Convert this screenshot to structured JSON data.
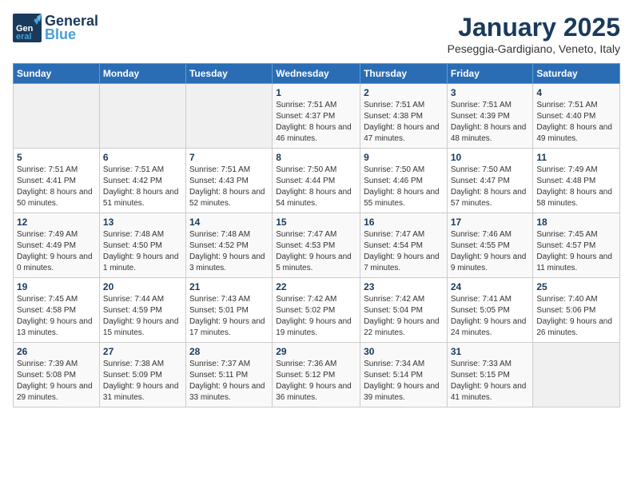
{
  "header": {
    "logo_general": "General",
    "logo_blue": "Blue",
    "month": "January 2025",
    "location": "Peseggia-Gardigiano, Veneto, Italy"
  },
  "days_of_week": [
    "Sunday",
    "Monday",
    "Tuesday",
    "Wednesday",
    "Thursday",
    "Friday",
    "Saturday"
  ],
  "weeks": [
    [
      {
        "num": "",
        "info": ""
      },
      {
        "num": "",
        "info": ""
      },
      {
        "num": "",
        "info": ""
      },
      {
        "num": "1",
        "info": "Sunrise: 7:51 AM\nSunset: 4:37 PM\nDaylight: 8 hours and 46 minutes."
      },
      {
        "num": "2",
        "info": "Sunrise: 7:51 AM\nSunset: 4:38 PM\nDaylight: 8 hours and 47 minutes."
      },
      {
        "num": "3",
        "info": "Sunrise: 7:51 AM\nSunset: 4:39 PM\nDaylight: 8 hours and 48 minutes."
      },
      {
        "num": "4",
        "info": "Sunrise: 7:51 AM\nSunset: 4:40 PM\nDaylight: 8 hours and 49 minutes."
      }
    ],
    [
      {
        "num": "5",
        "info": "Sunrise: 7:51 AM\nSunset: 4:41 PM\nDaylight: 8 hours and 50 minutes."
      },
      {
        "num": "6",
        "info": "Sunrise: 7:51 AM\nSunset: 4:42 PM\nDaylight: 8 hours and 51 minutes."
      },
      {
        "num": "7",
        "info": "Sunrise: 7:51 AM\nSunset: 4:43 PM\nDaylight: 8 hours and 52 minutes."
      },
      {
        "num": "8",
        "info": "Sunrise: 7:50 AM\nSunset: 4:44 PM\nDaylight: 8 hours and 54 minutes."
      },
      {
        "num": "9",
        "info": "Sunrise: 7:50 AM\nSunset: 4:46 PM\nDaylight: 8 hours and 55 minutes."
      },
      {
        "num": "10",
        "info": "Sunrise: 7:50 AM\nSunset: 4:47 PM\nDaylight: 8 hours and 57 minutes."
      },
      {
        "num": "11",
        "info": "Sunrise: 7:49 AM\nSunset: 4:48 PM\nDaylight: 8 hours and 58 minutes."
      }
    ],
    [
      {
        "num": "12",
        "info": "Sunrise: 7:49 AM\nSunset: 4:49 PM\nDaylight: 9 hours and 0 minutes."
      },
      {
        "num": "13",
        "info": "Sunrise: 7:48 AM\nSunset: 4:50 PM\nDaylight: 9 hours and 1 minute."
      },
      {
        "num": "14",
        "info": "Sunrise: 7:48 AM\nSunset: 4:52 PM\nDaylight: 9 hours and 3 minutes."
      },
      {
        "num": "15",
        "info": "Sunrise: 7:47 AM\nSunset: 4:53 PM\nDaylight: 9 hours and 5 minutes."
      },
      {
        "num": "16",
        "info": "Sunrise: 7:47 AM\nSunset: 4:54 PM\nDaylight: 9 hours and 7 minutes."
      },
      {
        "num": "17",
        "info": "Sunrise: 7:46 AM\nSunset: 4:55 PM\nDaylight: 9 hours and 9 minutes."
      },
      {
        "num": "18",
        "info": "Sunrise: 7:45 AM\nSunset: 4:57 PM\nDaylight: 9 hours and 11 minutes."
      }
    ],
    [
      {
        "num": "19",
        "info": "Sunrise: 7:45 AM\nSunset: 4:58 PM\nDaylight: 9 hours and 13 minutes."
      },
      {
        "num": "20",
        "info": "Sunrise: 7:44 AM\nSunset: 4:59 PM\nDaylight: 9 hours and 15 minutes."
      },
      {
        "num": "21",
        "info": "Sunrise: 7:43 AM\nSunset: 5:01 PM\nDaylight: 9 hours and 17 minutes."
      },
      {
        "num": "22",
        "info": "Sunrise: 7:42 AM\nSunset: 5:02 PM\nDaylight: 9 hours and 19 minutes."
      },
      {
        "num": "23",
        "info": "Sunrise: 7:42 AM\nSunset: 5:04 PM\nDaylight: 9 hours and 22 minutes."
      },
      {
        "num": "24",
        "info": "Sunrise: 7:41 AM\nSunset: 5:05 PM\nDaylight: 9 hours and 24 minutes."
      },
      {
        "num": "25",
        "info": "Sunrise: 7:40 AM\nSunset: 5:06 PM\nDaylight: 9 hours and 26 minutes."
      }
    ],
    [
      {
        "num": "26",
        "info": "Sunrise: 7:39 AM\nSunset: 5:08 PM\nDaylight: 9 hours and 29 minutes."
      },
      {
        "num": "27",
        "info": "Sunrise: 7:38 AM\nSunset: 5:09 PM\nDaylight: 9 hours and 31 minutes."
      },
      {
        "num": "28",
        "info": "Sunrise: 7:37 AM\nSunset: 5:11 PM\nDaylight: 9 hours and 33 minutes."
      },
      {
        "num": "29",
        "info": "Sunrise: 7:36 AM\nSunset: 5:12 PM\nDaylight: 9 hours and 36 minutes."
      },
      {
        "num": "30",
        "info": "Sunrise: 7:34 AM\nSunset: 5:14 PM\nDaylight: 9 hours and 39 minutes."
      },
      {
        "num": "31",
        "info": "Sunrise: 7:33 AM\nSunset: 5:15 PM\nDaylight: 9 hours and 41 minutes."
      },
      {
        "num": "",
        "info": ""
      }
    ]
  ]
}
